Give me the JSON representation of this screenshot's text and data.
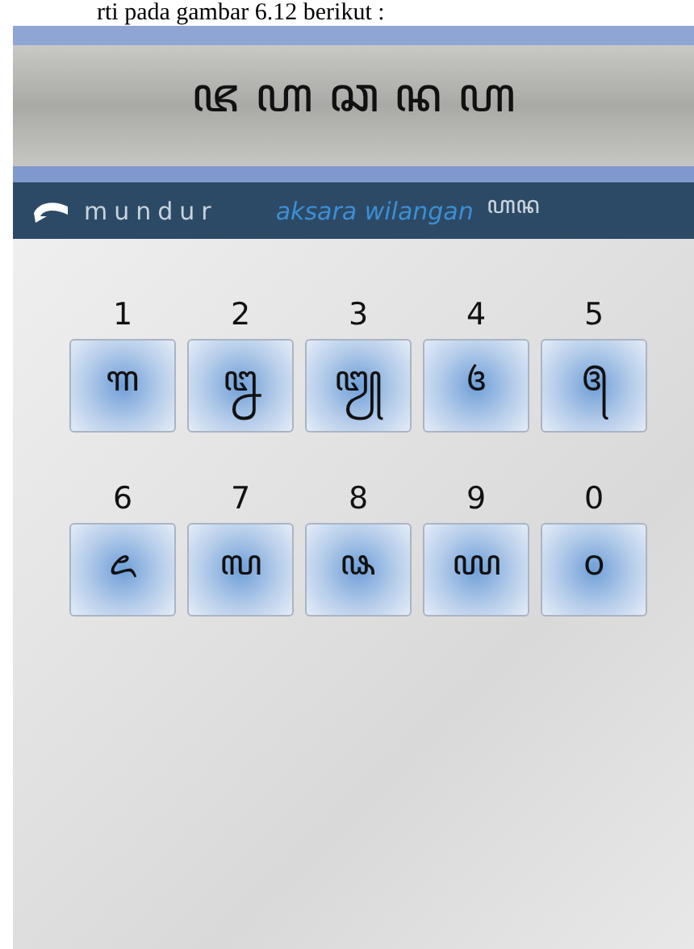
{
  "caption": "rti pada gambar 6.12 berikut :",
  "header": {
    "title": "ꦗ ꦲ ꦕ ꦤ ꦲ"
  },
  "nav": {
    "back_label": "mundur",
    "section": "aksara wilangan",
    "cut_text": "ꦲꦤ"
  },
  "numerals": [
    {
      "number": "1",
      "glyph": "꧑"
    },
    {
      "number": "2",
      "glyph": "꧒"
    },
    {
      "number": "3",
      "glyph": "꧓"
    },
    {
      "number": "4",
      "glyph": "꧔"
    },
    {
      "number": "5",
      "glyph": "꧕"
    },
    {
      "number": "6",
      "glyph": "꧖"
    },
    {
      "number": "7",
      "glyph": "꧗"
    },
    {
      "number": "8",
      "glyph": "꧘"
    },
    {
      "number": "9",
      "glyph": "꧙"
    },
    {
      "number": "0",
      "glyph": "꧐"
    }
  ]
}
